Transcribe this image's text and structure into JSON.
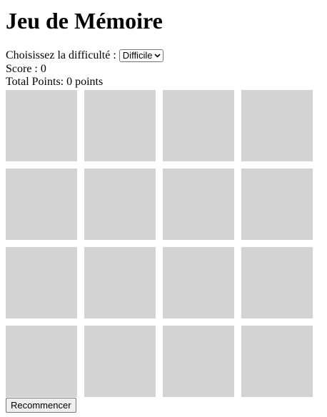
{
  "title": "Jeu de Mémoire",
  "difficulty": {
    "label": "Choisissez la difficulté :",
    "selected": "Difficile",
    "chevron_icon": "chevron-down-icon"
  },
  "score_text": "Score : 0",
  "total_points_text": "Total Points: 0 points",
  "board": {
    "rows": 4,
    "columns": 4,
    "card_color": "#d3d3d3",
    "face_down_cards": 16
  },
  "restart_label": "Recommencer"
}
